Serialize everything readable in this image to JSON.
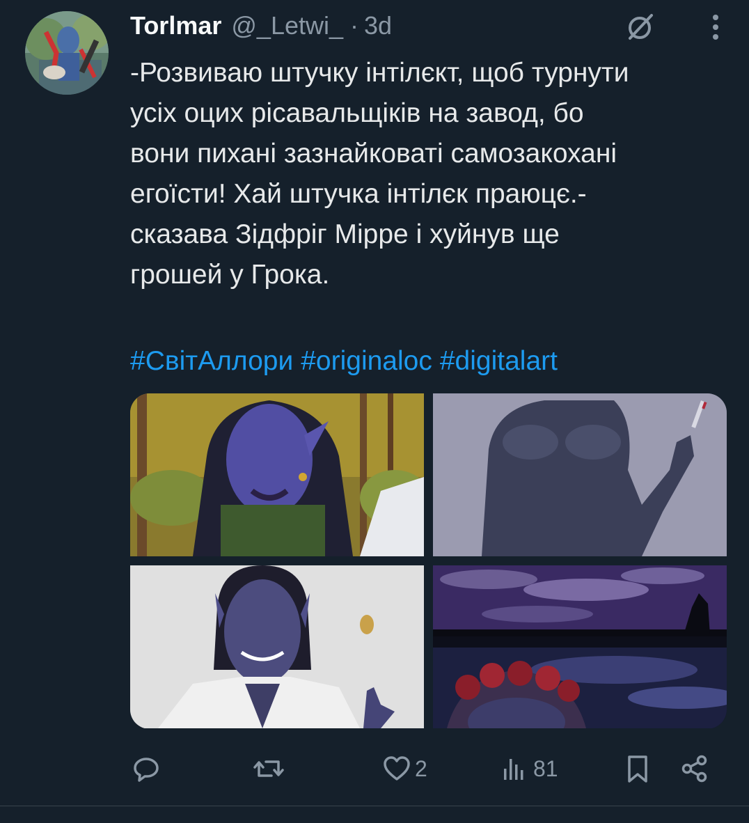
{
  "tweet": {
    "author": {
      "display_name": "Torlmar",
      "handle": "@_Letwi_",
      "avatar_icon": "avatar-image"
    },
    "separator": "·",
    "timestamp": "3d",
    "body": "-Розвиваю штучку інтілєкт, щоб турнути\nусіх оцих рісавальщіків на завод, бо\nвони пихані зазнайковаті самозакохані\nегоїсти! Хай штучка інтілєк праюцє.-\nсказава Зідфріг Мірре і хуйнув ще\nгрошей у Грока.",
    "hashtags": [
      "#СвітАллори",
      "#originaloc",
      "#digitalart"
    ],
    "media": [
      {
        "icon": "portrait-elf-forest-image"
      },
      {
        "icon": "torso-knife-image"
      },
      {
        "icon": "elf-coin-toss-image"
      },
      {
        "icon": "night-sky-roses-image"
      }
    ],
    "actions": {
      "reply": {
        "icon": "reply-icon",
        "count": ""
      },
      "retweet": {
        "icon": "retweet-icon",
        "count": ""
      },
      "like": {
        "icon": "heart-icon",
        "count": "2"
      },
      "views": {
        "icon": "views-icon",
        "count": "81"
      },
      "bookmark": {
        "icon": "bookmark-icon"
      },
      "share": {
        "icon": "share-icon"
      }
    },
    "header_icons": {
      "grok": "grok-icon",
      "more": "more-vertical-icon"
    }
  },
  "colors": {
    "background": "#15202b",
    "text": "#e7e9ea",
    "secondary_text": "#8b98a5",
    "link": "#1d9bf0",
    "divider": "#38444d"
  }
}
